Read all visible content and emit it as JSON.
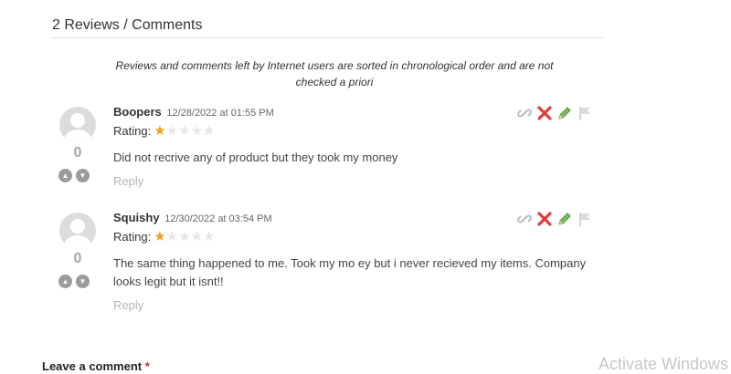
{
  "reviews_header": {
    "title": "2 Reviews / Comments"
  },
  "notice": "Reviews and comments left by Internet users are sorted in chronological order and are not checked a priori",
  "comments": [
    {
      "author": "Boopers",
      "date": "12/28/2022 at 01:55 PM",
      "rating_label": "Rating:",
      "rating": 1,
      "rating_max": 5,
      "score": "0",
      "text": "Did not recrive any of product but they took my money",
      "reply_label": "Reply"
    },
    {
      "author": "Squishy",
      "date": "12/30/2022 at 03:54 PM",
      "rating_label": "Rating:",
      "rating": 1,
      "rating_max": 5,
      "score": "0",
      "text": "The same thing happened to me. Took my mo ey but i never recieved my items. Company looks legit but it isnt!!",
      "reply_label": "Reply"
    }
  ],
  "leave_comment": {
    "label": "Leave a comment",
    "required_mark": "*"
  },
  "watermark": "Activate Windows",
  "colors": {
    "star_on": "#f0a11c",
    "star_off": "#e6e6e6",
    "delete": "#e23b3b",
    "edit": "#6ab04c",
    "muted": "#b5b5b5"
  }
}
